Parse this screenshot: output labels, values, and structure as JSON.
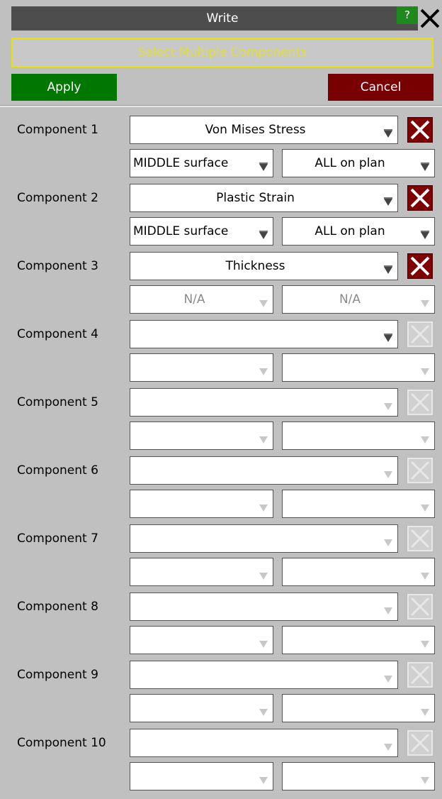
{
  "window": {
    "title": "Write",
    "help_label": "?",
    "mode_label": "Select Multiple Components",
    "apply_label": "Apply",
    "cancel_label": "Cancel"
  },
  "components": [
    {
      "label": "Component 1",
      "value": "Von Mises Stress",
      "surface": "MIDDLE surface",
      "plan": "ALL on plan",
      "enabled": true,
      "sub_dim": false
    },
    {
      "label": "Component 2",
      "value": "Plastic Strain",
      "surface": "MIDDLE surface",
      "plan": "ALL on plan",
      "enabled": true,
      "sub_dim": false
    },
    {
      "label": "Component 3",
      "value": "Thickness",
      "surface": "N/A",
      "plan": "N/A",
      "enabled": true,
      "sub_dim": true
    },
    {
      "label": "Component 4",
      "value": "",
      "surface": "",
      "plan": "",
      "enabled": "partial",
      "sub_dim": true
    },
    {
      "label": "Component 5",
      "value": "",
      "surface": "",
      "plan": "",
      "enabled": false,
      "sub_dim": true
    },
    {
      "label": "Component 6",
      "value": "",
      "surface": "",
      "plan": "",
      "enabled": false,
      "sub_dim": true
    },
    {
      "label": "Component 7",
      "value": "",
      "surface": "",
      "plan": "",
      "enabled": false,
      "sub_dim": true
    },
    {
      "label": "Component 8",
      "value": "",
      "surface": "",
      "plan": "",
      "enabled": false,
      "sub_dim": true
    },
    {
      "label": "Component 9",
      "value": "",
      "surface": "",
      "plan": "",
      "enabled": false,
      "sub_dim": true
    },
    {
      "label": "Component 10",
      "value": "",
      "surface": "",
      "plan": "",
      "enabled": false,
      "sub_dim": true
    }
  ],
  "colors": {
    "apply": "#007800",
    "cancel": "#780000",
    "delete_active": "#800000",
    "mode_border": "#e8e200",
    "title_bg": "#4d4d4d"
  },
  "icons": {
    "dropdown": "dropdown-arrow-icon",
    "delete": "delete-x-icon",
    "close": "close-icon",
    "help": "help-icon"
  }
}
